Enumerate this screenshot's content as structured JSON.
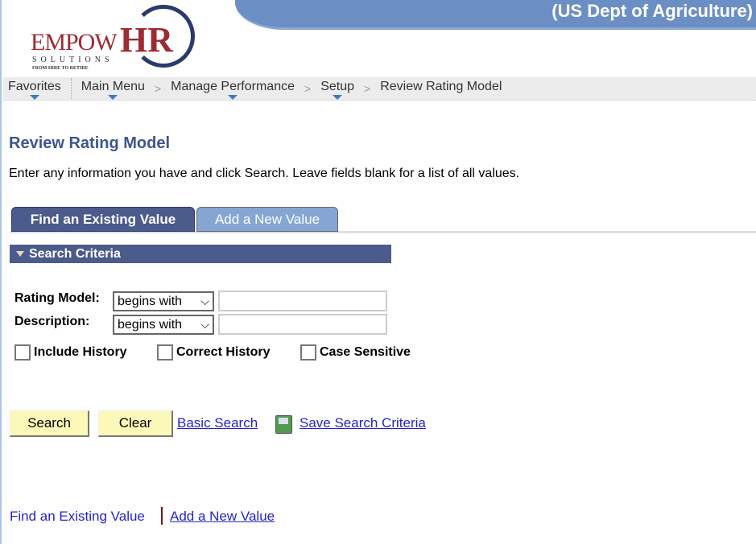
{
  "header": {
    "org": "(US Dept of Agriculture)",
    "logo": {
      "brand": "EmpowHR",
      "line1": "EMPOW",
      "line2": "HR",
      "sub": "SOLUTIONS",
      "tagline": "FROM HIRE TO RETIRE"
    }
  },
  "nav": {
    "items": [
      "Favorites",
      "Main Menu",
      "Manage Performance",
      "Setup",
      "Review Rating Model"
    ]
  },
  "page": {
    "title": "Review Rating Model",
    "instructions": "Enter any information you have and click Search. Leave fields blank for a list of all values."
  },
  "tabs": [
    {
      "label": "Find an Existing Value",
      "active": true
    },
    {
      "label": "Add a New Value",
      "active": false
    }
  ],
  "search_criteria": {
    "header": "Search Criteria",
    "fields": [
      {
        "label": "Rating Model:",
        "operator": "begins with",
        "value": ""
      },
      {
        "label": "Description:",
        "operator": "begins with",
        "value": ""
      }
    ],
    "checkboxes": [
      {
        "label": "Include History",
        "checked": false
      },
      {
        "label": "Correct History",
        "checked": false
      },
      {
        "label": "Case Sensitive",
        "checked": false
      }
    ]
  },
  "actions": {
    "search": "Search",
    "clear": "Clear",
    "basic_search": "Basic Search",
    "save_criteria": "Save Search Criteria"
  },
  "footer": {
    "find": "Find an Existing Value",
    "add": "Add a New Value"
  },
  "colors": {
    "banner": "#6b8fc4",
    "header_bar": "#4a5b8c",
    "button_bg": "#fcf9b8",
    "link": "#2424c8"
  }
}
